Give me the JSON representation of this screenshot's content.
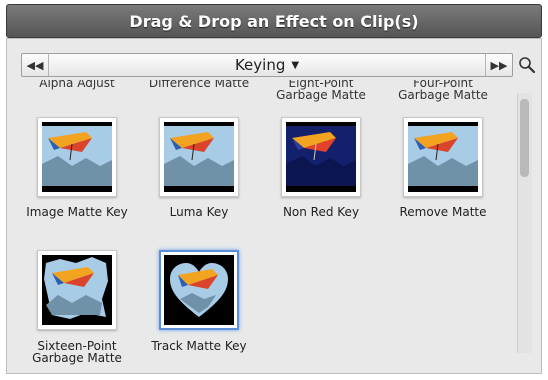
{
  "window": {
    "title": "Drag & Drop an Effect on Clip(s)"
  },
  "nav": {
    "prev_icon": "skip-back-icon",
    "next_icon": "skip-forward-icon",
    "category": "Keying",
    "search_icon": "magnifier-icon"
  },
  "effects_partial_row": [
    {
      "line1": "Alpha Adjust",
      "line2": ""
    },
    {
      "line1": "Difference Matte",
      "line2": ""
    },
    {
      "line1": "Eight-Point",
      "line2": "Garbage Matte"
    },
    {
      "line1": "Four-Point",
      "line2": "Garbage Matte"
    }
  ],
  "effects_row1": [
    {
      "line1": "Image Matte Key",
      "line2": ""
    },
    {
      "line1": "Luma Key",
      "line2": ""
    },
    {
      "line1": "Non Red Key",
      "line2": ""
    },
    {
      "line1": "Remove Matte",
      "line2": ""
    }
  ],
  "effects_row2": [
    {
      "line1": "Sixteen-Point",
      "line2": "Garbage Matte"
    },
    {
      "line1": "Track Matte Key",
      "line2": ""
    }
  ]
}
